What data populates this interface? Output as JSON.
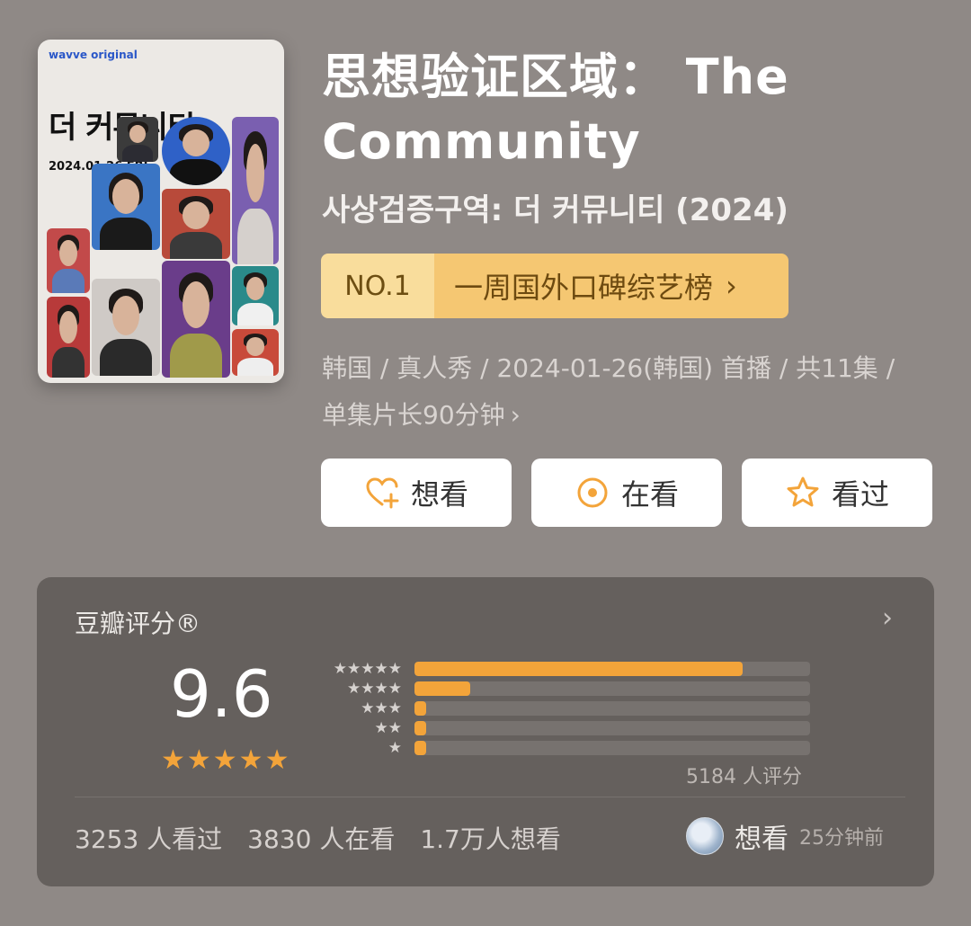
{
  "poster": {
    "brand": "wavve original",
    "title_ko": "더 커뮤니티",
    "date": "2024.01.26 FRI."
  },
  "title": "思想验证区域： The Community",
  "subtitle": "사상검증구역: 더 커뮤니티 (2024)",
  "ranking": {
    "badge": "NO.1",
    "list_label": "一周国外口碑综艺榜",
    "chevron": "›"
  },
  "meta": {
    "line1": "韩国 / 真人秀 / 2024-01-26(韩国) 首播 / 共11集 /",
    "line2": "单集片长90分钟",
    "more": "›"
  },
  "actions": [
    {
      "label": "想看",
      "icon": "heart-plus-icon"
    },
    {
      "label": "在看",
      "icon": "target-icon"
    },
    {
      "label": "看过",
      "icon": "star-icon"
    }
  ],
  "rating": {
    "title": "豆瓣评分®",
    "score": "9.6",
    "stars_display": "★★★★★",
    "star_labels": [
      "★★★★★",
      "★★★★",
      "★★★",
      "★★",
      "★"
    ],
    "distribution": [
      0.83,
      0.14,
      0.03,
      0.03,
      0.03
    ],
    "count": "5184 人评分",
    "watched": "3253 人看过",
    "watching": "3830 人在看",
    "wish": "1.7万人想看",
    "recent_action": "想看",
    "recent_time": "25分钟前"
  },
  "colors": {
    "accent": "#f3a43a",
    "background": "#8f8986",
    "panel": "#65605d"
  }
}
